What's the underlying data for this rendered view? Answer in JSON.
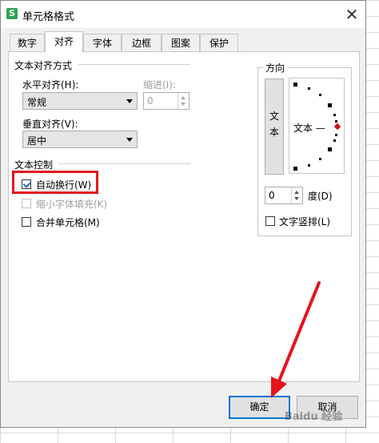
{
  "dialog": {
    "title": "单元格格式",
    "app_icon_letter": "S",
    "close_glyph": "✕"
  },
  "tabs": [
    {
      "label": "数字",
      "active": false
    },
    {
      "label": "对齐",
      "active": true
    },
    {
      "label": "字体",
      "active": false
    },
    {
      "label": "边框",
      "active": false
    },
    {
      "label": "图案",
      "active": false
    },
    {
      "label": "保护",
      "active": false
    }
  ],
  "text_alignment": {
    "group_title": "文本对齐方式",
    "horizontal_label": "水平对齐(H):",
    "horizontal_value": "常规",
    "indent_label": "缩进(I):",
    "indent_value": "0",
    "vertical_label": "垂直对齐(V):",
    "vertical_value": "居中"
  },
  "text_control": {
    "group_title": "文本控制",
    "wrap_label": "自动换行(W)",
    "wrap_checked": true,
    "shrink_label": "缩小字体填充(K)",
    "shrink_checked": false,
    "shrink_enabled": false,
    "merge_label": "合并单元格(M)",
    "merge_checked": false
  },
  "orientation": {
    "group_title": "方向",
    "vertical_text_char1": "文",
    "vertical_text_char2": "本",
    "dial_text": "文本 —",
    "degree_value": "0",
    "degree_label": "度(D)",
    "vertical_stack_label": "文字竖排(L)",
    "vertical_stack_checked": false
  },
  "buttons": {
    "ok_label": "确定",
    "cancel_label": "取消"
  },
  "watermark": "Baidu 经验",
  "colors": {
    "highlight_red": "#e6141d",
    "primary_blue": "#0078d7",
    "check_blue": "#2468b0",
    "app_icon_green": "#2ea44f"
  }
}
